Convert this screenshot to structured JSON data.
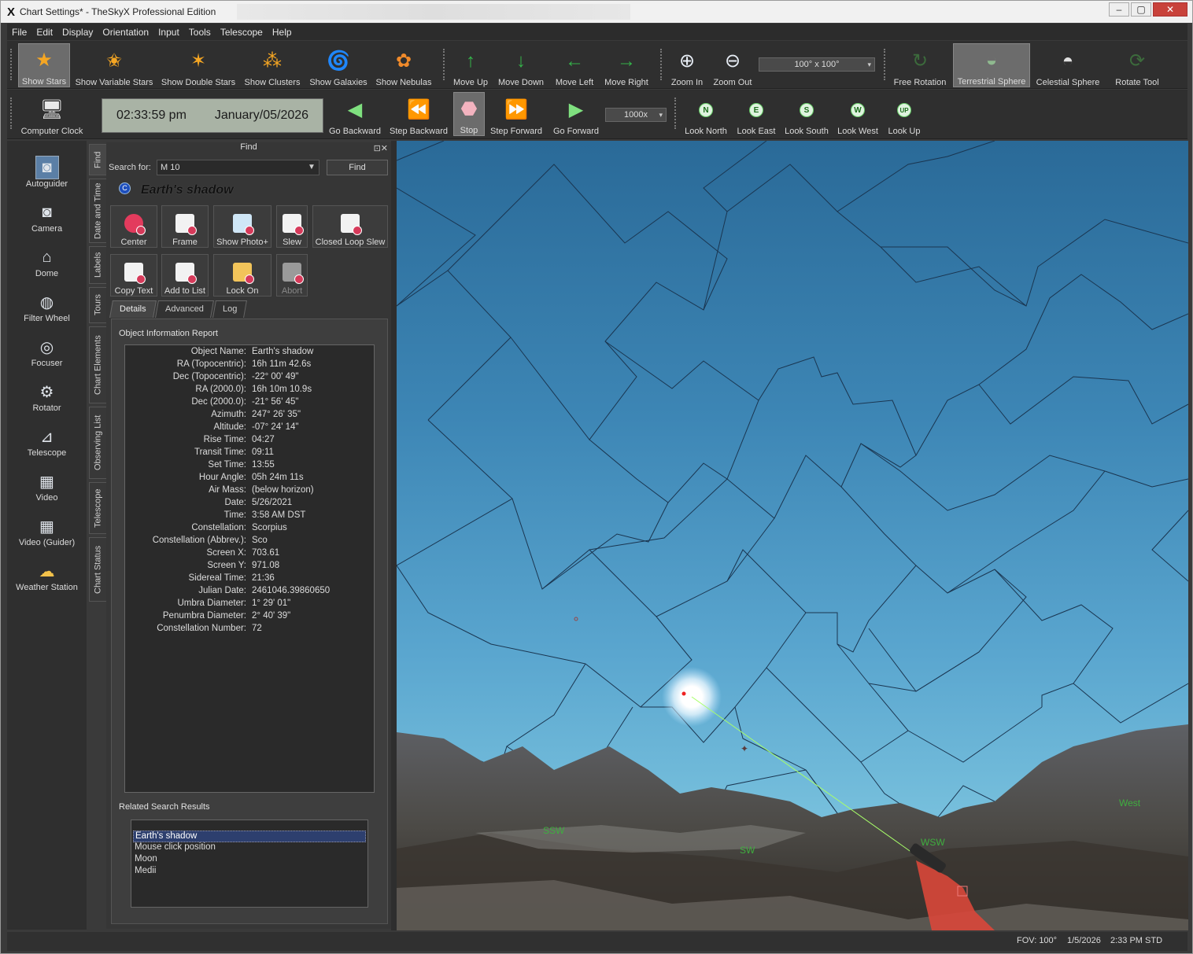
{
  "window": {
    "app_logo": "X",
    "title": "Chart Settings* - TheSkyX Professional Edition",
    "buttons": {
      "minimize": "‒",
      "maximize": "▢",
      "close": "✕"
    }
  },
  "menu": [
    "File",
    "Edit",
    "Display",
    "Orientation",
    "Input",
    "Tools",
    "Telescope",
    "Help"
  ],
  "toolbar1": {
    "items": [
      {
        "label": "Show Stars",
        "icon": "star-icon"
      },
      {
        "label": "Show Variable Stars",
        "icon": "variable-star-icon"
      },
      {
        "label": "Show Double Stars",
        "icon": "double-star-icon"
      },
      {
        "label": "Show Clusters",
        "icon": "cluster-icon"
      },
      {
        "label": "Show Galaxies",
        "icon": "galaxy-icon"
      },
      {
        "label": "Show Nebulas",
        "icon": "nebula-icon"
      },
      {
        "label": "Move Up",
        "icon": "arrow-up-icon"
      },
      {
        "label": "Move Down",
        "icon": "arrow-down-icon"
      },
      {
        "label": "Move Left",
        "icon": "arrow-left-icon"
      },
      {
        "label": "Move Right",
        "icon": "arrow-right-icon"
      },
      {
        "label": "Zoom In",
        "icon": "zoom-in-icon"
      },
      {
        "label": "Zoom Out",
        "icon": "zoom-out-icon"
      },
      {
        "label": "Free Rotation",
        "icon": "free-rotation-icon"
      },
      {
        "label": "Terrestrial Sphere",
        "icon": "terrestrial-sphere-icon"
      },
      {
        "label": "Celestial Sphere",
        "icon": "celestial-sphere-icon"
      },
      {
        "label": "Rotate Tool",
        "icon": "rotate-tool-icon"
      }
    ],
    "fov_select": "100° x 100°"
  },
  "toolbar2": {
    "computer_clock": "Computer Clock",
    "time": "02:33:59 pm",
    "date": "January/05/2026",
    "items": [
      {
        "label": "Go Backward",
        "icon": "go-backward-icon"
      },
      {
        "label": "Step Backward",
        "icon": "step-backward-icon"
      },
      {
        "label": "Stop",
        "icon": "stop-icon"
      },
      {
        "label": "Step Forward",
        "icon": "step-forward-icon"
      },
      {
        "label": "Go Forward",
        "icon": "go-forward-icon"
      }
    ],
    "rate_select": "1000x",
    "look": [
      {
        "label": "Look North",
        "badge": "N"
      },
      {
        "label": "Look East",
        "badge": "E"
      },
      {
        "label": "Look South",
        "badge": "S"
      },
      {
        "label": "Look West",
        "badge": "W"
      },
      {
        "label": "Look Up",
        "badge": "UP"
      }
    ]
  },
  "left_bar": [
    {
      "label": "Autoguider",
      "icon": "autoguider-icon"
    },
    {
      "label": "Camera",
      "icon": "camera-icon"
    },
    {
      "label": "Dome",
      "icon": "dome-icon"
    },
    {
      "label": "Filter Wheel",
      "icon": "filter-wheel-icon"
    },
    {
      "label": "Focuser",
      "icon": "focuser-icon"
    },
    {
      "label": "Rotator",
      "icon": "rotator-icon"
    },
    {
      "label": "Telescope",
      "icon": "telescope-icon"
    },
    {
      "label": "Video",
      "icon": "video-icon"
    },
    {
      "label": "Video (Guider)",
      "icon": "video-guider-icon"
    },
    {
      "label": "Weather Station",
      "icon": "weather-station-icon"
    }
  ],
  "vertical_tabs": [
    "Find",
    "Date and Time",
    "Labels",
    "Tours",
    "Chart Elements",
    "Observing List",
    "Telescope",
    "Chart Status"
  ],
  "find": {
    "panel_title": "Find",
    "search_label": "Search for:",
    "search_value": "M 10",
    "find_button": "Find",
    "object_name": "Earth's shadow",
    "actions": [
      "Center",
      "Frame",
      "Show Photo+",
      "Slew",
      "Closed Loop Slew",
      "Copy Text",
      "Add to List",
      "Lock On",
      "Abort"
    ],
    "tabs": [
      "Details",
      "Advanced",
      "Log"
    ],
    "report_title": "Object Information Report",
    "report": [
      {
        "k": "Object Name:",
        "v": "Earth's shadow"
      },
      {
        "k": "RA (Topocentric):",
        "v": "16h 11m 42.6s"
      },
      {
        "k": "Dec (Topocentric):",
        "v": "-22° 00' 49\""
      },
      {
        "k": "RA (2000.0):",
        "v": "16h 10m 10.9s"
      },
      {
        "k": "Dec (2000.0):",
        "v": "-21° 56' 45\""
      },
      {
        "k": "Azimuth:",
        "v": "247° 26' 35\""
      },
      {
        "k": "Altitude:",
        "v": "-07° 24' 14\""
      },
      {
        "k": "Rise Time:",
        "v": "04:27"
      },
      {
        "k": "Transit Time:",
        "v": "09:11"
      },
      {
        "k": "Set Time:",
        "v": "13:55"
      },
      {
        "k": "Hour Angle:",
        "v": "05h 24m 11s"
      },
      {
        "k": "Air Mass:",
        "v": "(below horizon)"
      },
      {
        "k": "Date:",
        "v": "5/26/2021"
      },
      {
        "k": "Time:",
        "v": "3:58 AM DST"
      },
      {
        "k": "Constellation:",
        "v": "Scorpius"
      },
      {
        "k": "Constellation (Abbrev.):",
        "v": "Sco"
      },
      {
        "k": "Screen X:",
        "v": "703.61"
      },
      {
        "k": "Screen Y:",
        "v": "971.08"
      },
      {
        "k": "Sidereal Time:",
        "v": "21:36"
      },
      {
        "k": "Julian Date:",
        "v": "2461046.39860650"
      },
      {
        "k": "Umbra Diameter:",
        "v": "1° 29' 01\""
      },
      {
        "k": "Penumbra Diameter:",
        "v": "2° 40' 39\""
      },
      {
        "k": "Constellation Number:",
        "v": "72"
      }
    ],
    "related_title": "Related Search Results",
    "related": [
      "Earth's shadow",
      "Mouse click position",
      "Moon",
      "Medii"
    ]
  },
  "sky": {
    "compass_labels": [
      "SSW",
      "SW",
      "WSW",
      "West"
    ],
    "colors": {
      "sky_top": "#2a6a98",
      "sky_bottom": "#76bfdc",
      "boundary": "#1a3550",
      "label": "#3fae3f"
    }
  },
  "status": {
    "fov": "FOV: 100°",
    "date": "1/5/2026",
    "time": "2:33 PM STD"
  }
}
